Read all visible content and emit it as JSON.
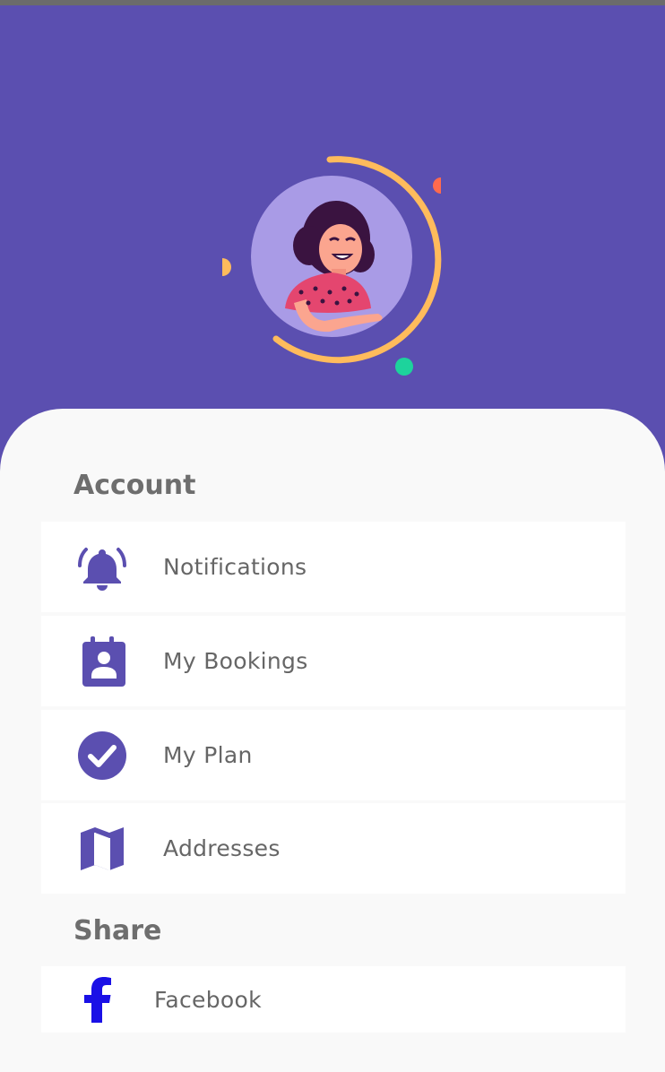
{
  "account": {
    "title": "Account",
    "items": [
      {
        "label": "Notifications",
        "icon": "bell-icon"
      },
      {
        "label": "My Bookings",
        "icon": "booking-icon"
      },
      {
        "label": "My Plan",
        "icon": "check-circle-icon"
      },
      {
        "label": "Addresses",
        "icon": "map-icon"
      }
    ]
  },
  "share": {
    "title": "Share",
    "items": [
      {
        "label": "Facebook",
        "icon": "facebook-icon"
      }
    ]
  },
  "colors": {
    "primary": "#5b4fb0",
    "avatar_bg": "#a99be6",
    "ring": "#ffbb5c",
    "dot_green": "#1dd39c",
    "accent_orange": "#ff6a4d",
    "facebook": "#1a10e6"
  }
}
